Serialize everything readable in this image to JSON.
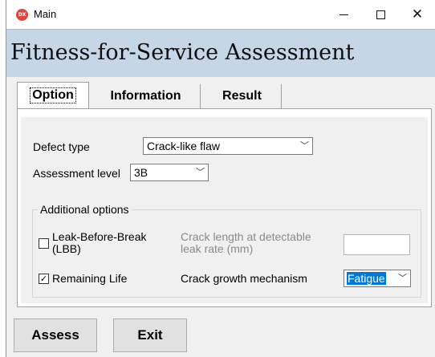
{
  "window": {
    "icon_text": "DX",
    "title": "Main",
    "controls": {
      "minimize": "—",
      "maximize": "□",
      "close": "✕"
    }
  },
  "header": {
    "title": "Fitness-for-Service Assessment"
  },
  "tabs": [
    {
      "label": "Option",
      "selected": true
    },
    {
      "label": "Information",
      "selected": false
    },
    {
      "label": "Result",
      "selected": false
    }
  ],
  "option": {
    "defect_type": {
      "label": "Defect type",
      "value": "Crack-like flaw"
    },
    "assessment_level": {
      "label": "Assessment level",
      "value": "3B"
    },
    "additional": {
      "legend": "Additional options",
      "lbb": {
        "label_line1": "Leak-Before-Break",
        "label_line2": "(LBB)",
        "checked": false,
        "crack_length_line1": "Crack length at detectable",
        "crack_length_line2": "leak rate (mm)",
        "crack_length_value": ""
      },
      "remaining_life": {
        "label": "Remaining Life",
        "checked": true,
        "check_glyph": "✓",
        "mechanism_label": "Crack growth mechanism",
        "mechanism_value": "Fatigue"
      }
    }
  },
  "actions": {
    "assess": "Assess",
    "exit": "Exit"
  },
  "icons": {
    "chevron": "﹀"
  },
  "colors": {
    "header_band": "#c5d7e6",
    "selection": "#0078d7",
    "app_icon": "#e0463a"
  }
}
